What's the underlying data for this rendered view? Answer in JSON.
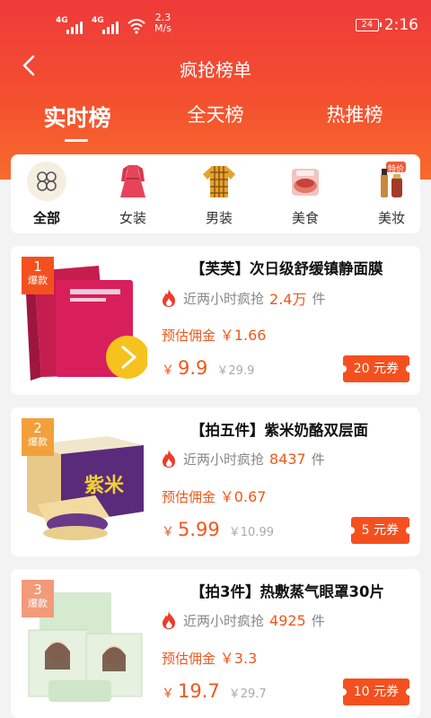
{
  "status_bar": {
    "net1": "4G",
    "net2": "4G",
    "speed_value": "2.3",
    "speed_unit": "M/s",
    "battery": "24",
    "time": "2:16"
  },
  "header": {
    "title": "疯抢榜单"
  },
  "tabs": [
    {
      "label": "实时榜",
      "active": true
    },
    {
      "label": "全天榜",
      "active": false
    },
    {
      "label": "热推榜",
      "active": false
    }
  ],
  "categories": [
    {
      "label": "全部",
      "icon": "clover-icon",
      "active": true
    },
    {
      "label": "女装",
      "icon": "dress-icon"
    },
    {
      "label": "男装",
      "icon": "shirt-icon"
    },
    {
      "label": "美食",
      "icon": "food-icon"
    },
    {
      "label": "美妆",
      "icon": "cosmetics-icon",
      "badge": "特价"
    }
  ],
  "products": [
    {
      "rank": "1",
      "rank_tag": "爆款",
      "title": "【芙芙】次日级舒缓镇静面膜",
      "hot_prefix": "近两小时疯抢",
      "hot_value": "2.4万",
      "hot_unit": "件",
      "commission_label": "预估佣金",
      "commission": "￥1.66",
      "currency": "￥",
      "price": "9.9",
      "orig_price": "￥29.9",
      "coupon": "20 元券",
      "thumb": "mask-pack-image"
    },
    {
      "rank": "2",
      "rank_tag": "爆款",
      "title": "【拍五件】紫米奶酪双层面",
      "hot_prefix": "近两小时疯抢",
      "hot_value": "8437",
      "hot_unit": "件",
      "commission_label": "预估佣金",
      "commission": "￥0.67",
      "currency": "￥",
      "price": "5.99",
      "orig_price": "￥10.99",
      "coupon": "5 元券",
      "thumb": "bread-box-image",
      "thumb_text": "紫米"
    },
    {
      "rank": "3",
      "rank_tag": "爆款",
      "title": "【拍3件】热敷蒸气眼罩30片",
      "hot_prefix": "近两小时疯抢",
      "hot_value": "4925",
      "hot_unit": "件",
      "commission_label": "预估佣金",
      "commission": "￥3.3",
      "currency": "￥",
      "price": "19.7",
      "orig_price": "￥29.7",
      "coupon": "10 元券",
      "thumb": "eye-mask-image"
    }
  ],
  "colors": {
    "header_top": "#ee3a3a",
    "header_bottom": "#f76a2d",
    "accent": "#f0571d",
    "rank1": "#f4501f",
    "rank2": "#f2a03a",
    "rank3": "#f29a7a"
  }
}
